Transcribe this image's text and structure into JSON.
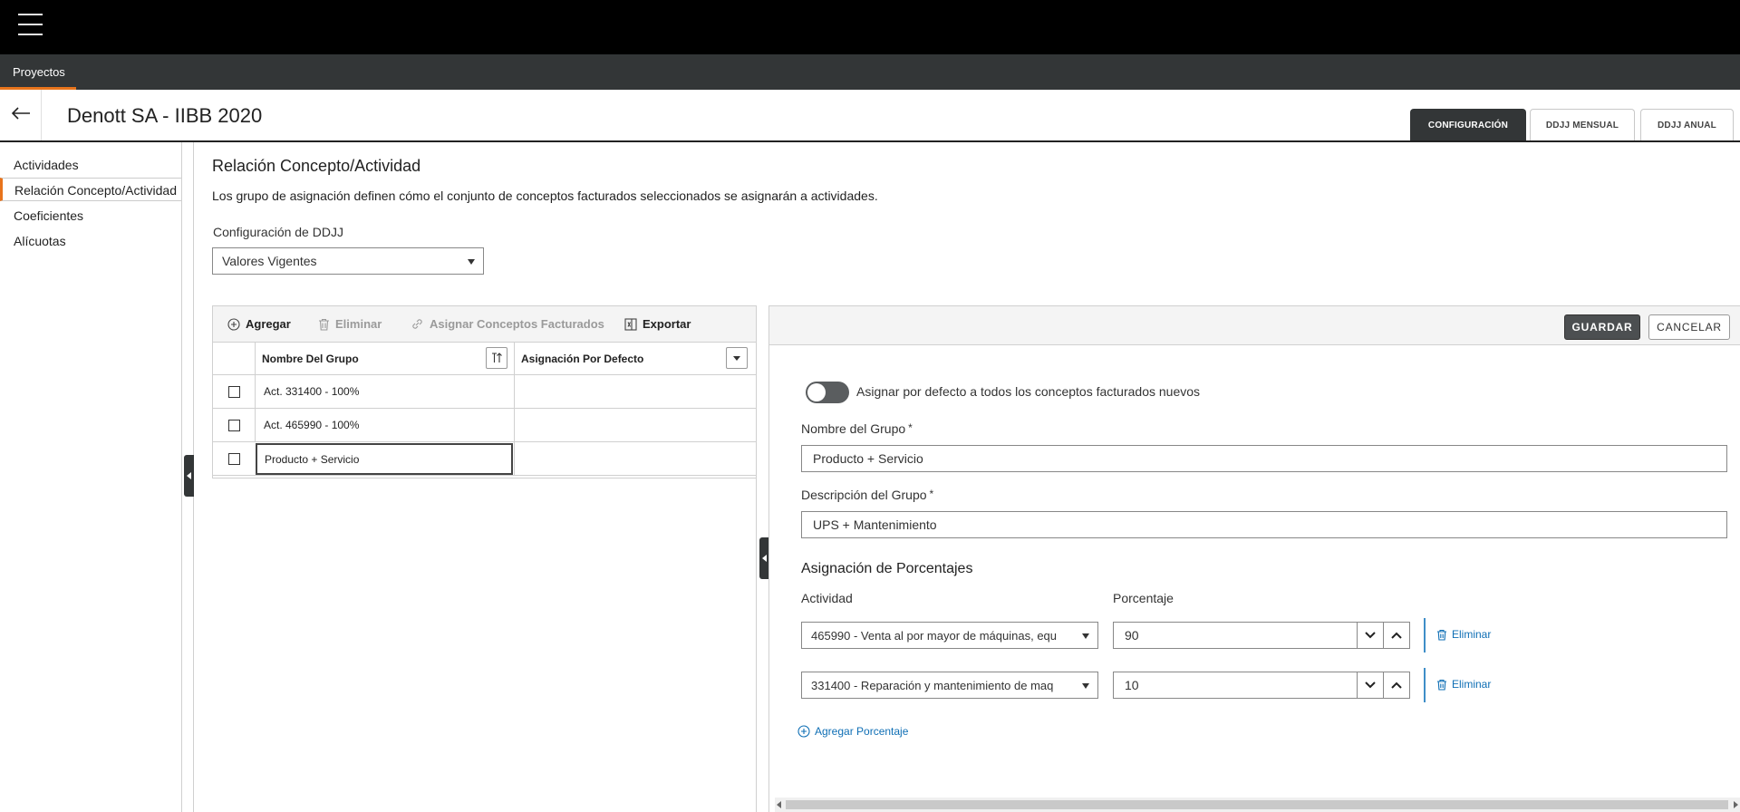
{
  "topbar": {
    "menu_icon": "hamburger-menu-icon"
  },
  "nav": {
    "tab_label": "Proyectos"
  },
  "header": {
    "title": "Denott SA - IIBB 2020",
    "tabs": [
      {
        "label": "CONFIGURACIÓN",
        "active": true
      },
      {
        "label": "DDJJ MENSUAL",
        "active": false
      },
      {
        "label": "DDJJ ANUAL",
        "active": false
      }
    ]
  },
  "sidebar": {
    "items": [
      {
        "label": "Actividades",
        "active": false
      },
      {
        "label": "Relación Concepto/Actividad",
        "active": true
      },
      {
        "label": "Coeficientes",
        "active": false
      },
      {
        "label": "Alícuotas",
        "active": false
      }
    ]
  },
  "section": {
    "title": "Relación Concepto/Actividad",
    "description": "Los grupo de asignación definen cómo el conjunto de conceptos facturados seleccionados se asignarán a actividades.",
    "config_label": "Configuración de DDJJ",
    "config_value": "Valores Vigentes"
  },
  "grid": {
    "toolbar": {
      "add": "Agregar",
      "delete": "Eliminar",
      "assign": "Asignar Conceptos Facturados",
      "export": "Exportar"
    },
    "columns": [
      "Nombre Del Grupo",
      "Asignación Por Defecto"
    ],
    "rows": [
      {
        "name": "Act. 331400 - 100%",
        "default": ""
      },
      {
        "name": "Act. 465990 - 100%",
        "default": ""
      },
      {
        "name": "Producto + Servicio",
        "default": "",
        "selected": true
      }
    ]
  },
  "form": {
    "save": "GUARDAR",
    "cancel": "CANCELAR",
    "toggle_label": "Asignar por defecto a todos los conceptos facturados nuevos",
    "toggle_on": false,
    "group_name_label": "Nombre del Grupo",
    "group_name_value": "Producto + Servicio",
    "group_desc_label": "Descripción del Grupo",
    "group_desc_value": "UPS + Mantenimiento",
    "required_mark": "*",
    "percent_section_title": "Asignación de Porcentajes",
    "col_activity": "Actividad",
    "col_percent": "Porcentaje",
    "allocations": [
      {
        "activity": "465990 - Venta al por mayor de máquinas, equ",
        "percent": "90"
      },
      {
        "activity": "331400 - Reparación y mantenimiento de maq",
        "percent": "10"
      }
    ],
    "remove_label": "Eliminar",
    "add_percent_label": "Agregar Porcentaje"
  },
  "colors": {
    "accent": "#e8741c",
    "topbar": "#000000",
    "navbar": "#333637",
    "link": "#0f6fb5"
  }
}
